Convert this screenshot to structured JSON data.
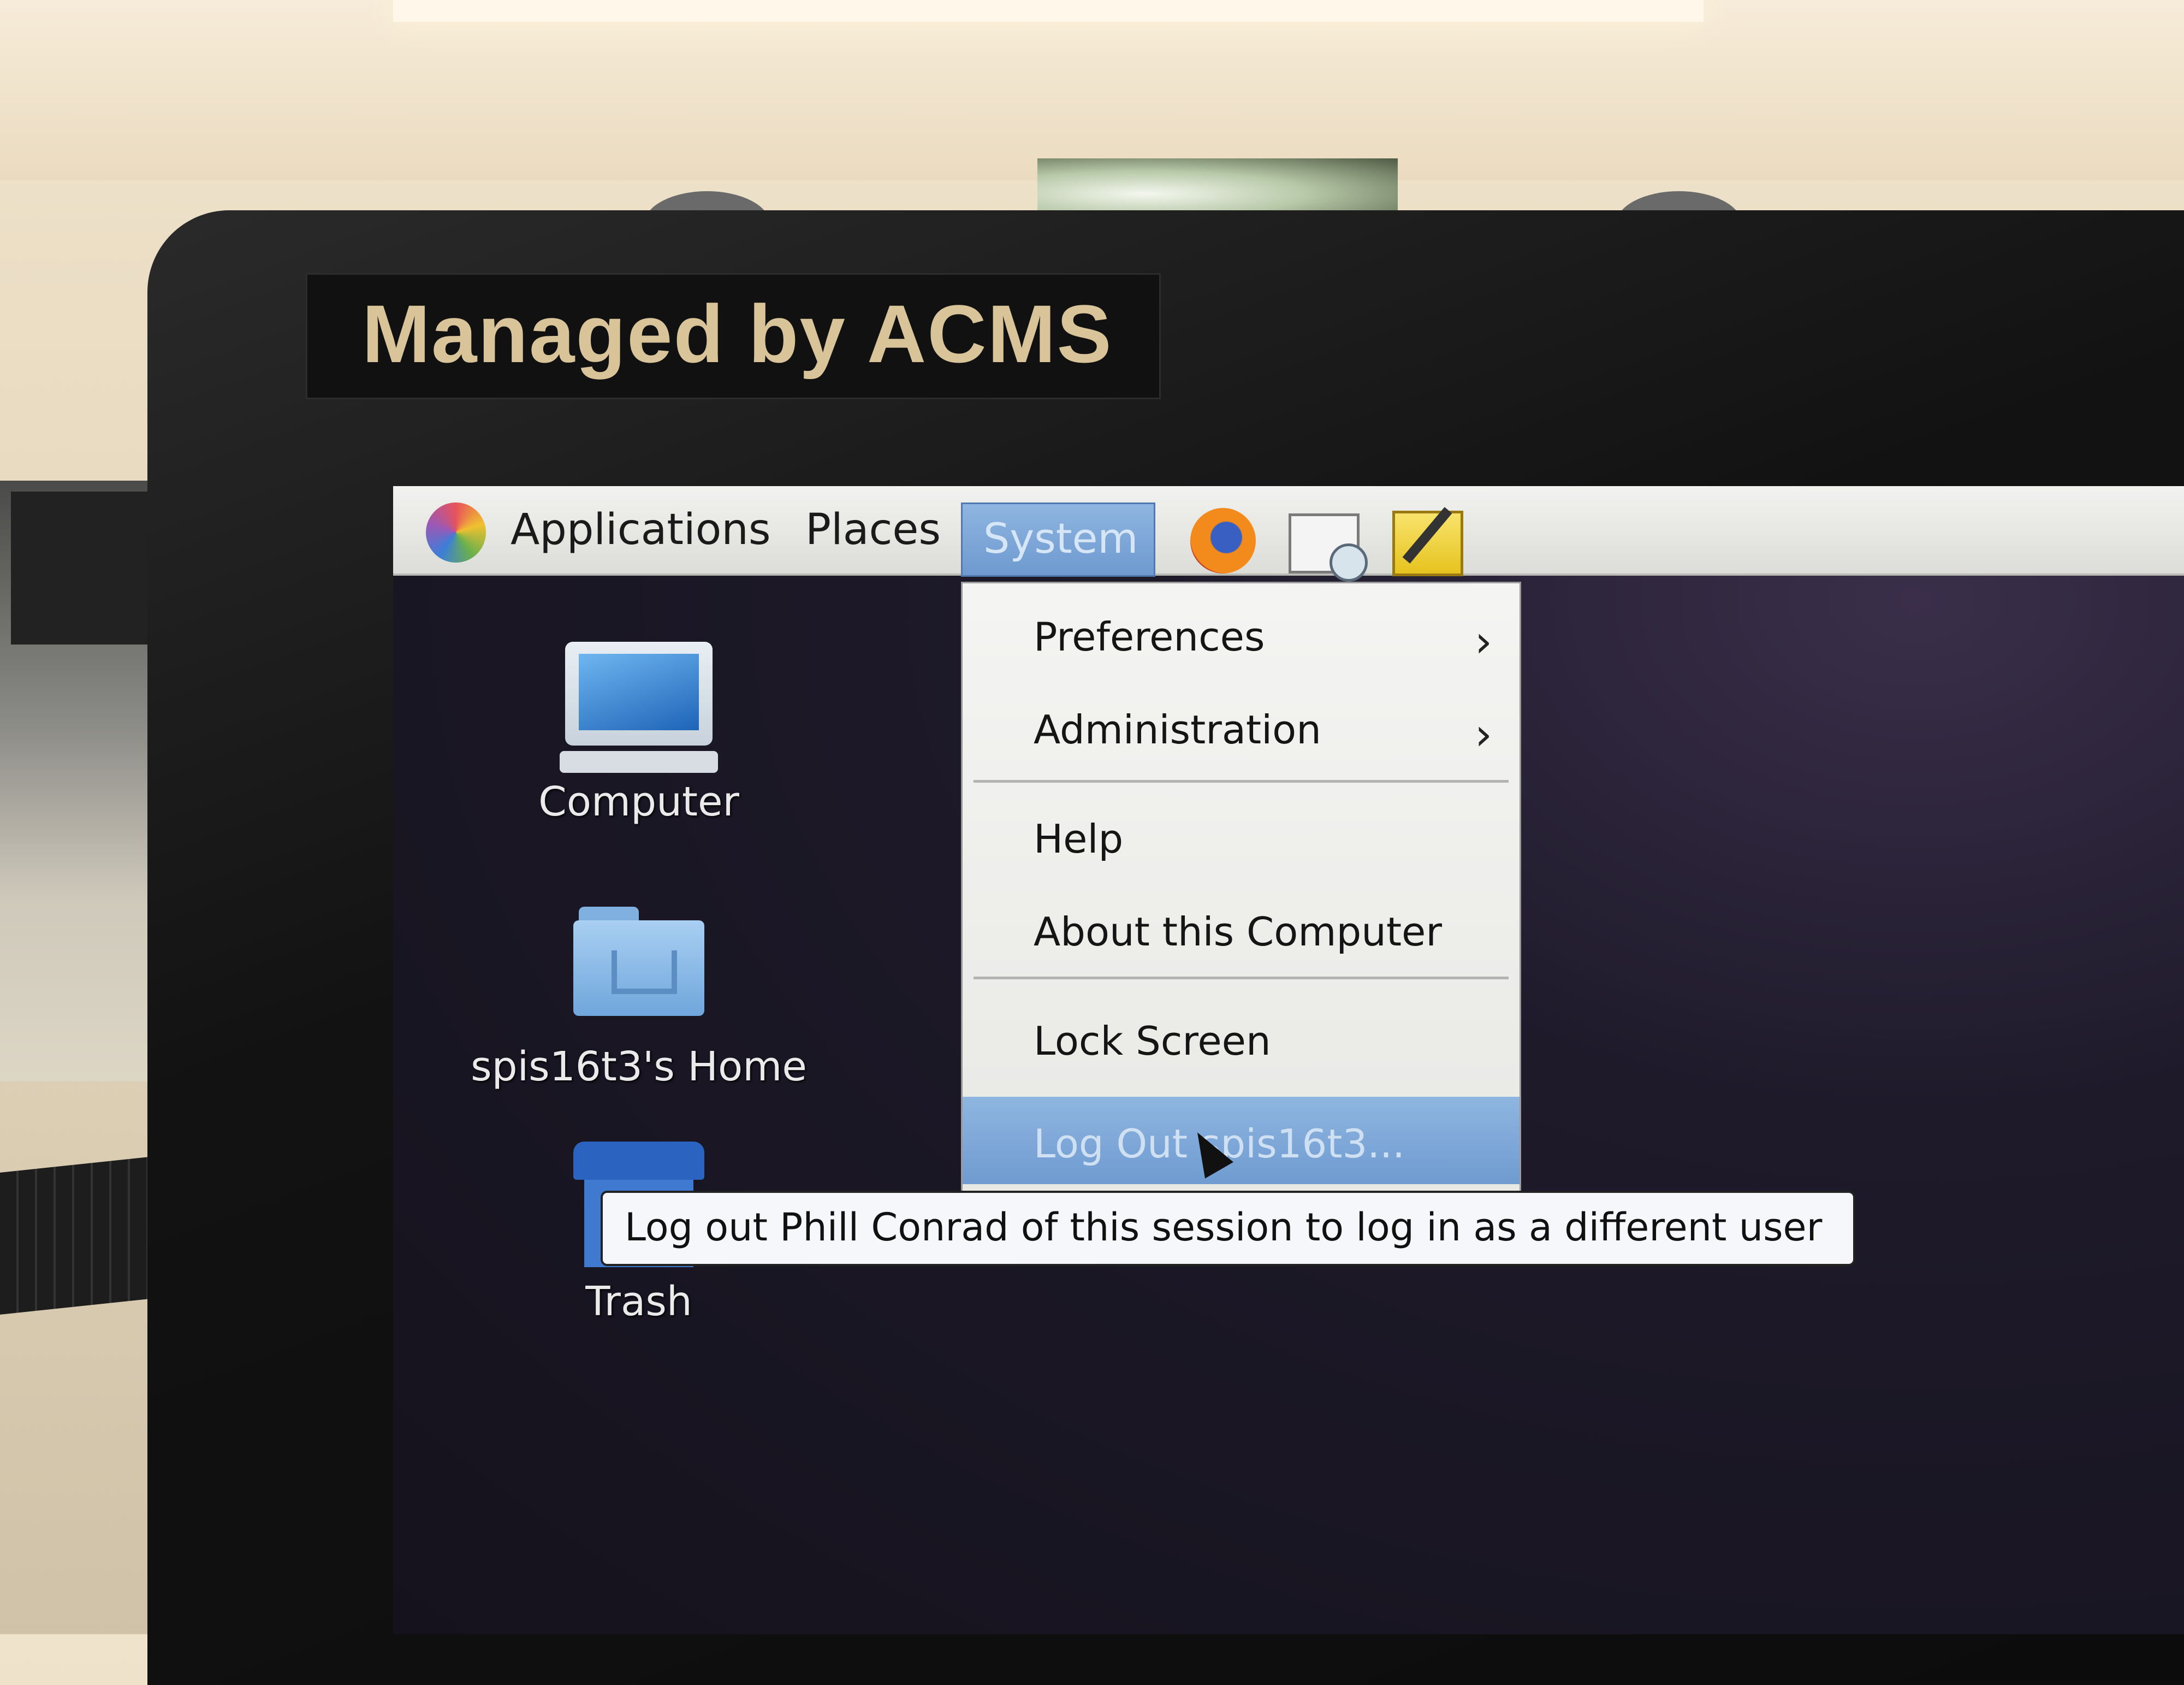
{
  "sticker": {
    "text": "Managed by ACMS"
  },
  "panel": {
    "applications": "Applications",
    "places": "Places",
    "system": "System",
    "launchers": [
      "firefox-icon",
      "mail-clock-icon",
      "notes-icon"
    ]
  },
  "system_menu": {
    "items": [
      {
        "label": "Preferences",
        "submenu": true
      },
      {
        "label": "Administration",
        "submenu": true
      },
      {
        "label": "Help",
        "submenu": false
      },
      {
        "label": "About this Computer",
        "submenu": false
      },
      {
        "label": "Lock Screen",
        "submenu": false
      },
      {
        "label": "Log Out spis16t3...",
        "submenu": false,
        "highlighted": true
      }
    ],
    "chevron": "›"
  },
  "desktop": {
    "icons": [
      {
        "label": "Computer"
      },
      {
        "label": "spis16t3's Home"
      },
      {
        "label": "Trash"
      }
    ]
  },
  "tooltip": {
    "text": "Log out Phill Conrad of this session to log in as a different user"
  },
  "colors": {
    "highlight": "#7fa8d8",
    "panel": "#e6e6e3",
    "desktop": "#1a1623"
  }
}
